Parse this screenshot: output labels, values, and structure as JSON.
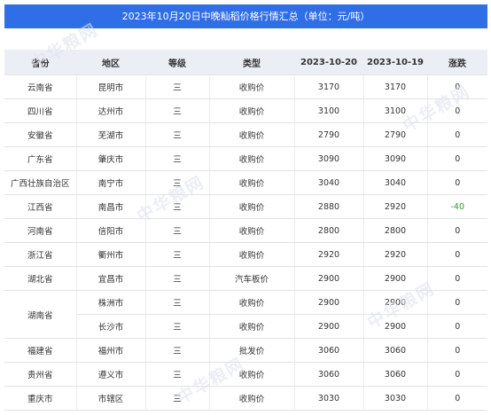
{
  "title": "2023年10月20日中晚籼稻价格行情汇总（单位：元/吨）",
  "watermark_text": "中华粮网",
  "colors": {
    "header_bar": "#2f6ee6",
    "table_header": "#eceef6",
    "negative": "#2e9b2e"
  },
  "columns": [
    "省份",
    "地区",
    "等级",
    "类型",
    "2023-10-20",
    "2023-10-19",
    "涨跌"
  ],
  "rows": [
    {
      "province": "云南省",
      "region": "昆明市",
      "grade": "三",
      "type": "收购价",
      "p1": "3170",
      "p2": "3170",
      "change": "0"
    },
    {
      "province": "四川省",
      "region": "达州市",
      "grade": "三",
      "type": "收购价",
      "p1": "3100",
      "p2": "3100",
      "change": "0"
    },
    {
      "province": "安徽省",
      "region": "芜湖市",
      "grade": "三",
      "type": "收购价",
      "p1": "2790",
      "p2": "2790",
      "change": "0"
    },
    {
      "province": "广东省",
      "region": "肇庆市",
      "grade": "三",
      "type": "收购价",
      "p1": "3090",
      "p2": "3090",
      "change": "0"
    },
    {
      "province": "广西壮族自治区",
      "region": "南宁市",
      "grade": "三",
      "type": "收购价",
      "p1": "3040",
      "p2": "3040",
      "change": "0"
    },
    {
      "province": "江西省",
      "region": "南昌市",
      "grade": "三",
      "type": "收购价",
      "p1": "2880",
      "p2": "2920",
      "change": "-40"
    },
    {
      "province": "河南省",
      "region": "信阳市",
      "grade": "三",
      "type": "收购价",
      "p1": "2800",
      "p2": "2800",
      "change": "0"
    },
    {
      "province": "浙江省",
      "region": "衢州市",
      "grade": "三",
      "type": "收购价",
      "p1": "2920",
      "p2": "2920",
      "change": "0"
    },
    {
      "province": "湖北省",
      "region": "宜昌市",
      "grade": "三",
      "type": "汽车板价",
      "p1": "2900",
      "p2": "2900",
      "change": "0"
    },
    {
      "province": "湖南省",
      "region": "株洲市",
      "grade": "三",
      "type": "收购价",
      "p1": "2900",
      "p2": "2900",
      "change": "0"
    },
    {
      "province": "",
      "region": "长沙市",
      "grade": "三",
      "type": "收购价",
      "p1": "2900",
      "p2": "2900",
      "change": "0"
    },
    {
      "province": "福建省",
      "region": "福州市",
      "grade": "三",
      "type": "批发价",
      "p1": "3060",
      "p2": "3060",
      "change": "0"
    },
    {
      "province": "贵州省",
      "region": "遵义市",
      "grade": "三",
      "type": "收购价",
      "p1": "3060",
      "p2": "3060",
      "change": "0"
    },
    {
      "province": "重庆市",
      "region": "市辖区",
      "grade": "三",
      "type": "收购价",
      "p1": "3030",
      "p2": "3030",
      "change": "0"
    }
  ]
}
